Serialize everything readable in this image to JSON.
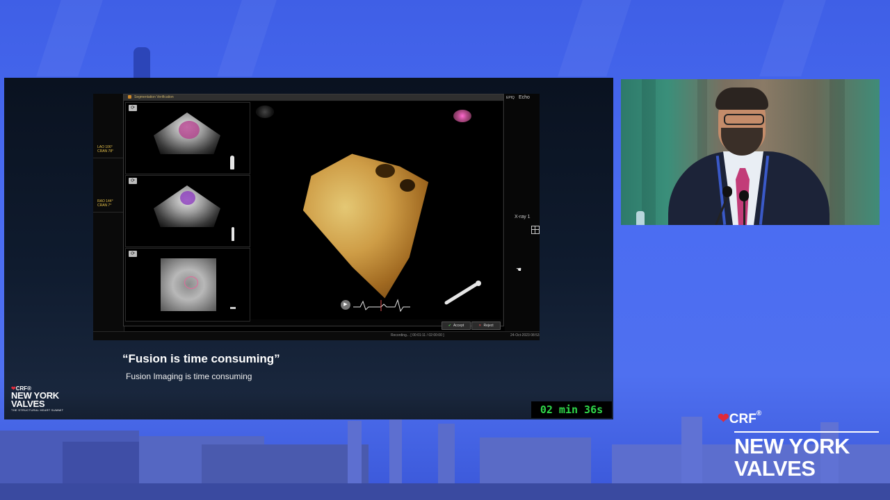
{
  "slide": {
    "quote": "“Fusion is time consuming”",
    "subtitle": "Fusion Imaging is time consuming",
    "timer": "02 min 36s"
  },
  "software": {
    "dialog_title": "Segmentation Verification",
    "left_labels": [
      "LAO 106°\nCRAN 78°",
      "RAO 144°\nCRAN 7°"
    ],
    "right_top_labels": [
      "EPIQ",
      "Echo"
    ],
    "right_mid_label": "X-ray 1",
    "accept_label": "Accept",
    "reject_label": "Reject",
    "status_recording": "Recording... [ 00:01:11 / 02:00:00 ]",
    "status_datetime": "24-Oct-2023 08:53"
  },
  "logos": {
    "crf": "CRF",
    "registered": "®",
    "new_york": "NEW YORK",
    "valves": "VALVES",
    "tagline": "THE STRUCTURAL HEART SUMMIT"
  },
  "colors": {
    "background": "#4a6cf2",
    "timer_text": "#2fd84a",
    "brand_red": "#e02a3a"
  }
}
